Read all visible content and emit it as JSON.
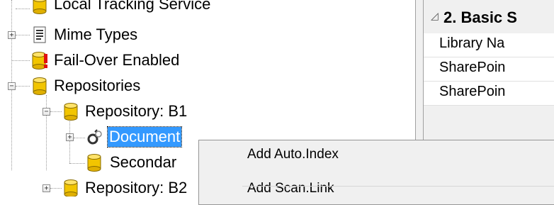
{
  "tree": {
    "nodes": [
      {
        "label": "Local Tracking Service"
      },
      {
        "label": "Mime Types",
        "expander": "+"
      },
      {
        "label": "Fail-Over Enabled"
      },
      {
        "label": "Repositories",
        "expander": "−"
      },
      {
        "label": "Repository: B1",
        "expander": "−"
      },
      {
        "label": "Document",
        "expander": "+",
        "selected": true
      },
      {
        "label": "Secondar"
      },
      {
        "label": "Repository: B2",
        "expander": "+"
      }
    ]
  },
  "context_menu": {
    "items": [
      {
        "label": "Add Auto.Index"
      },
      {
        "label": "Add Scan.Link"
      }
    ]
  },
  "properties": {
    "section_toggle": "◿",
    "section_title": "2. Basic S",
    "rows": [
      {
        "label": "Library Na"
      },
      {
        "label": "SharePoin"
      },
      {
        "label": "SharePoin"
      }
    ]
  },
  "colors": {
    "selection": "#3399ff",
    "db_icon": "#f2c500",
    "warning": "#e01010"
  }
}
